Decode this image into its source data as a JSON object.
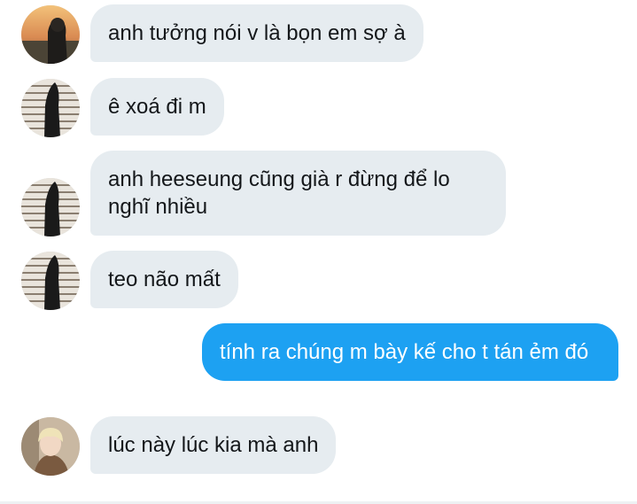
{
  "conversation": {
    "messages": [
      {
        "direction": "incoming",
        "avatar": "avatar-sunset-photo",
        "text": "anh tưởng nói v là bọn em sợ à"
      },
      {
        "direction": "incoming",
        "avatar": "avatar-window-silhouette",
        "text": "ê xoá đi m"
      },
      {
        "direction": "incoming",
        "avatar": "avatar-window-silhouette",
        "text": "anh heeseung cũng già r đừng để lo nghĩ nhiều"
      },
      {
        "direction": "incoming",
        "avatar": "avatar-window-silhouette",
        "text": "teo não mất"
      },
      {
        "direction": "outgoing",
        "text": "tính ra chúng m bày kế cho t tán ẻm đó"
      },
      {
        "direction": "incoming",
        "avatar": "avatar-blond-person",
        "text": "lúc này lúc kia mà anh"
      }
    ]
  },
  "colors": {
    "incoming_bubble": "#e6ecf0",
    "outgoing_bubble": "#1da1f2",
    "incoming_text": "#14171a",
    "outgoing_text": "#ffffff"
  }
}
